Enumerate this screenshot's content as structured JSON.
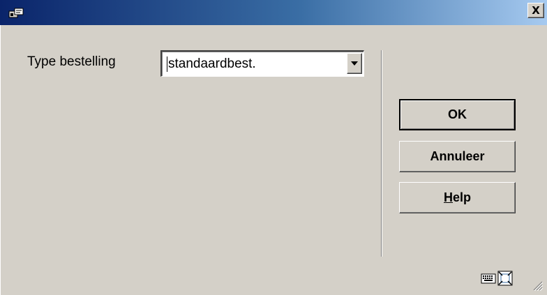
{
  "window": {
    "title": "",
    "icon": "app-icon",
    "close_label": "X"
  },
  "form": {
    "type_label": "Type bestelling",
    "type_value": "standaardbest."
  },
  "buttons": {
    "ok_label": "OK",
    "cancel_label": "Annuleer",
    "help_first": "H",
    "help_rest": "elp"
  },
  "status_icons": [
    "keyboard-icon",
    "fullscreen-icon"
  ],
  "colors": {
    "face": "#d4d0c8",
    "title_start": "#0a246a",
    "title_end": "#a6caf0"
  }
}
